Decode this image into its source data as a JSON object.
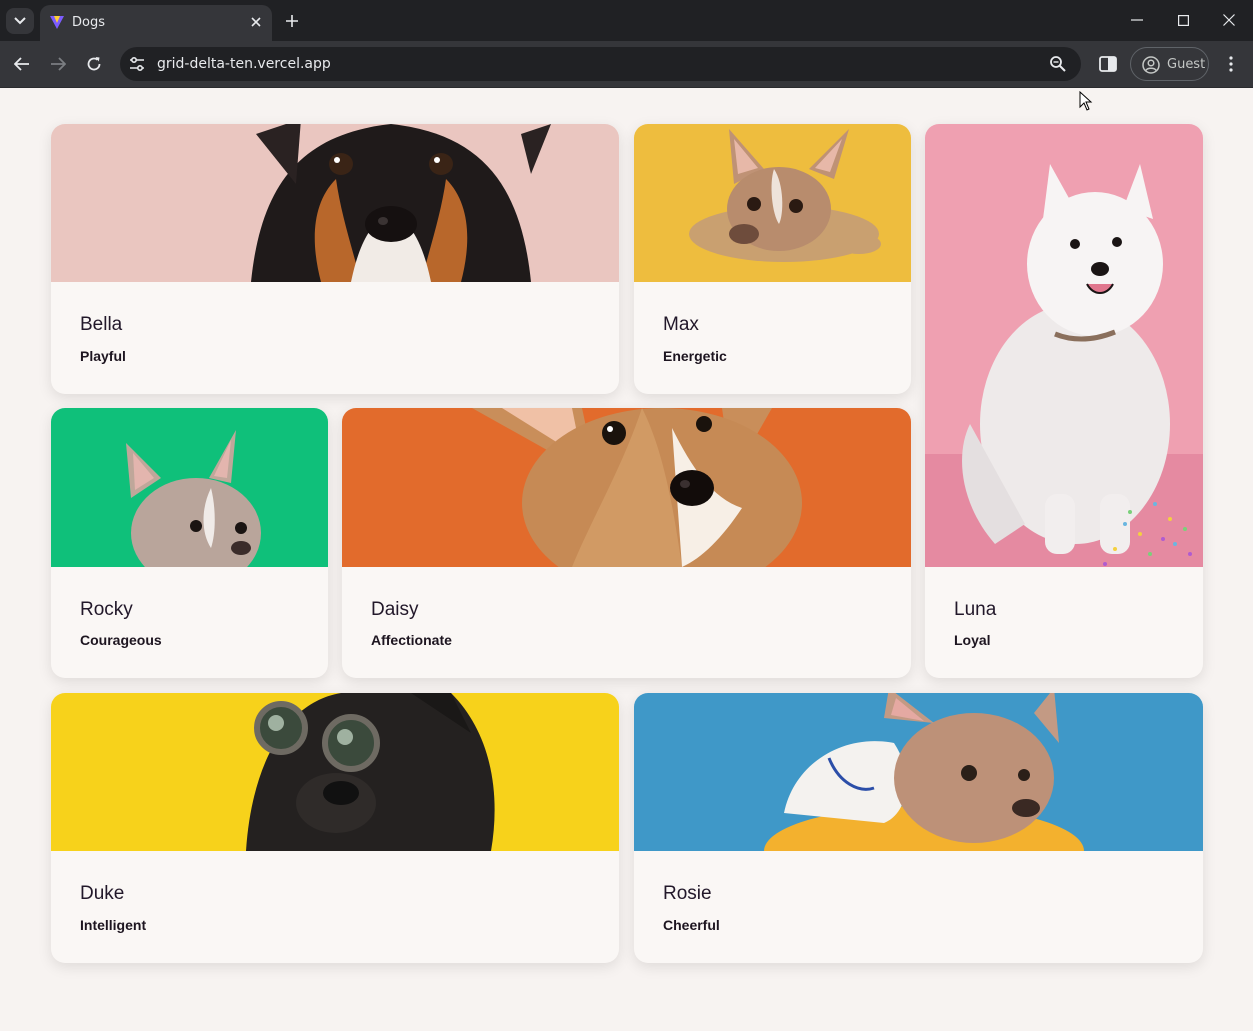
{
  "browser": {
    "tab_title": "Dogs",
    "url": "grid-delta-ten.vercel.app",
    "profile_label": "Guest",
    "icons": [
      "tab-search-icon",
      "favicon-icon",
      "close-icon",
      "plus-icon",
      "minimize-icon",
      "maximize-icon",
      "close-window-icon",
      "back-icon",
      "forward-icon",
      "reload-icon",
      "site-info-icon",
      "zoom-icon",
      "side-panel-icon",
      "profile-icon",
      "more-icon"
    ]
  },
  "dogs": [
    {
      "name": "Bella",
      "trait": "Playful",
      "photo_bg": "#eac6c0"
    },
    {
      "name": "Max",
      "trait": "Energetic",
      "photo_bg": "#eebd3e"
    },
    {
      "name": "Luna",
      "trait": "Loyal",
      "photo_bg": "#efa0b1"
    },
    {
      "name": "Rocky",
      "trait": "Courageous",
      "photo_bg": "#0fc07a"
    },
    {
      "name": "Daisy",
      "trait": "Affectionate",
      "photo_bg": "#e26b2c"
    },
    {
      "name": "Duke",
      "trait": "Intelligent",
      "photo_bg": "#f7d21b"
    },
    {
      "name": "Rosie",
      "trait": "Cheerful",
      "photo_bg": "#3f98c8"
    }
  ]
}
